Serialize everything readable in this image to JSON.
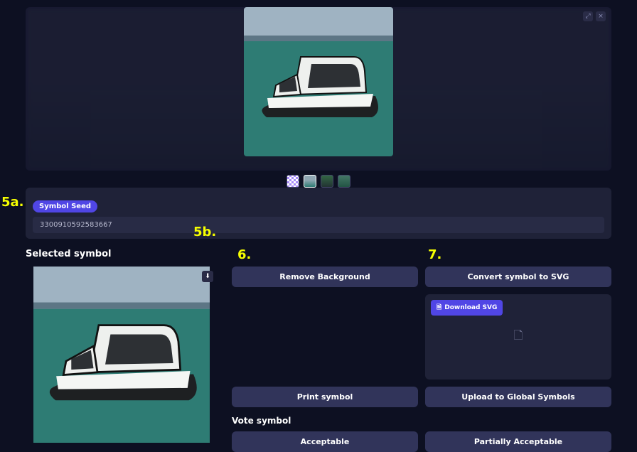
{
  "hero": {
    "expand_glyph": "⤢",
    "close_glyph": "×"
  },
  "seed": {
    "pill_label": "Symbol Seed",
    "value": "3300910592583667"
  },
  "selected": {
    "title": "Selected symbol",
    "download_glyph": "⬇"
  },
  "actions": {
    "remove_bg": "Remove Background",
    "convert_svg": "Convert symbol to SVG",
    "download_svg": "Download SVG",
    "svg_placeholder_glyph": "🗋",
    "print": "Print symbol",
    "upload": "Upload to Global Symbols"
  },
  "vote": {
    "title": "Vote symbol",
    "acceptable": "Acceptable",
    "partially": "Partially Acceptable"
  },
  "annotations": {
    "a5a": "5a.",
    "a5b": "5b.",
    "a6": "6.",
    "a7": "7."
  }
}
